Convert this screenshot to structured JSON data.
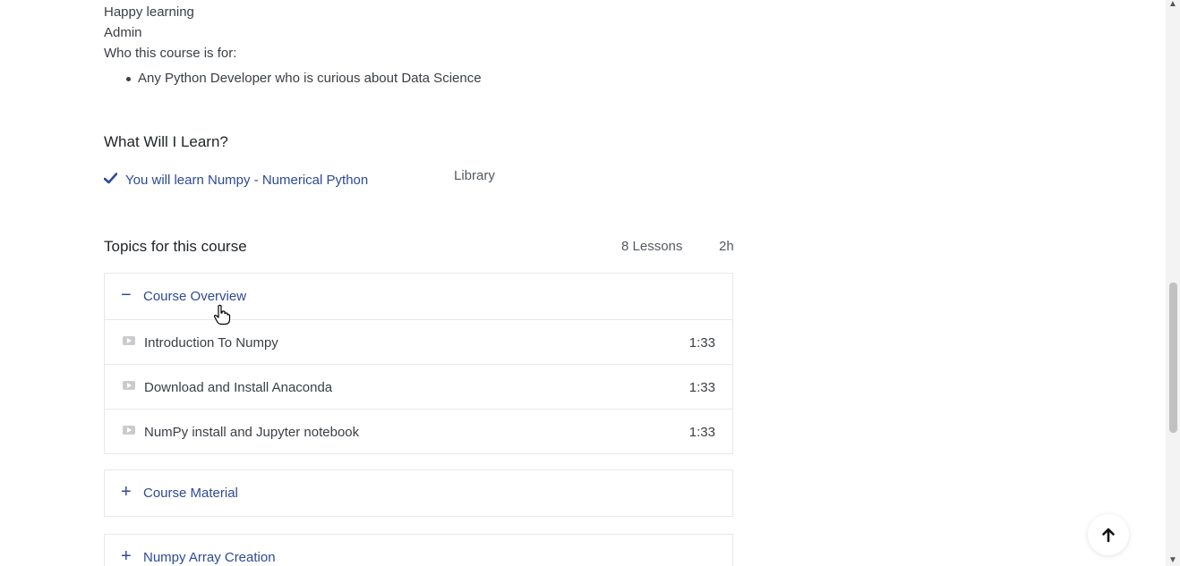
{
  "intro": {
    "line1": "Happy learning",
    "line2": "Admin",
    "audience_heading": "Who this course is for:",
    "audience_item": "Any Python Developer who is curious about Data Science"
  },
  "learn": {
    "heading": "What Will I Learn?",
    "item_text": "You will learn Numpy - Numerical Python",
    "item_suffix": "Library"
  },
  "topics": {
    "heading": "Topics for this course",
    "lessons_count": "8 Lessons",
    "total_duration": "2h",
    "sections": [
      {
        "toggle": "−",
        "title": "Course Overview",
        "expanded": true,
        "lessons": [
          {
            "title": "Introduction To Numpy",
            "duration": "1:33"
          },
          {
            "title": "Download and Install Anaconda",
            "duration": "1:33"
          },
          {
            "title": "NumPy install and Jupyter notebook",
            "duration": "1:33"
          }
        ]
      },
      {
        "toggle": "+",
        "title": "Course Material",
        "expanded": false
      },
      {
        "toggle": "+",
        "title": "Numpy Array Creation",
        "expanded": false
      }
    ]
  },
  "colors": {
    "accent": "#2c4a99",
    "text": "#3a3f44",
    "border": "#e6e8ea"
  },
  "icons": {
    "check": "check-icon",
    "video": "video-icon",
    "back_to_top": "arrow-up-icon"
  }
}
